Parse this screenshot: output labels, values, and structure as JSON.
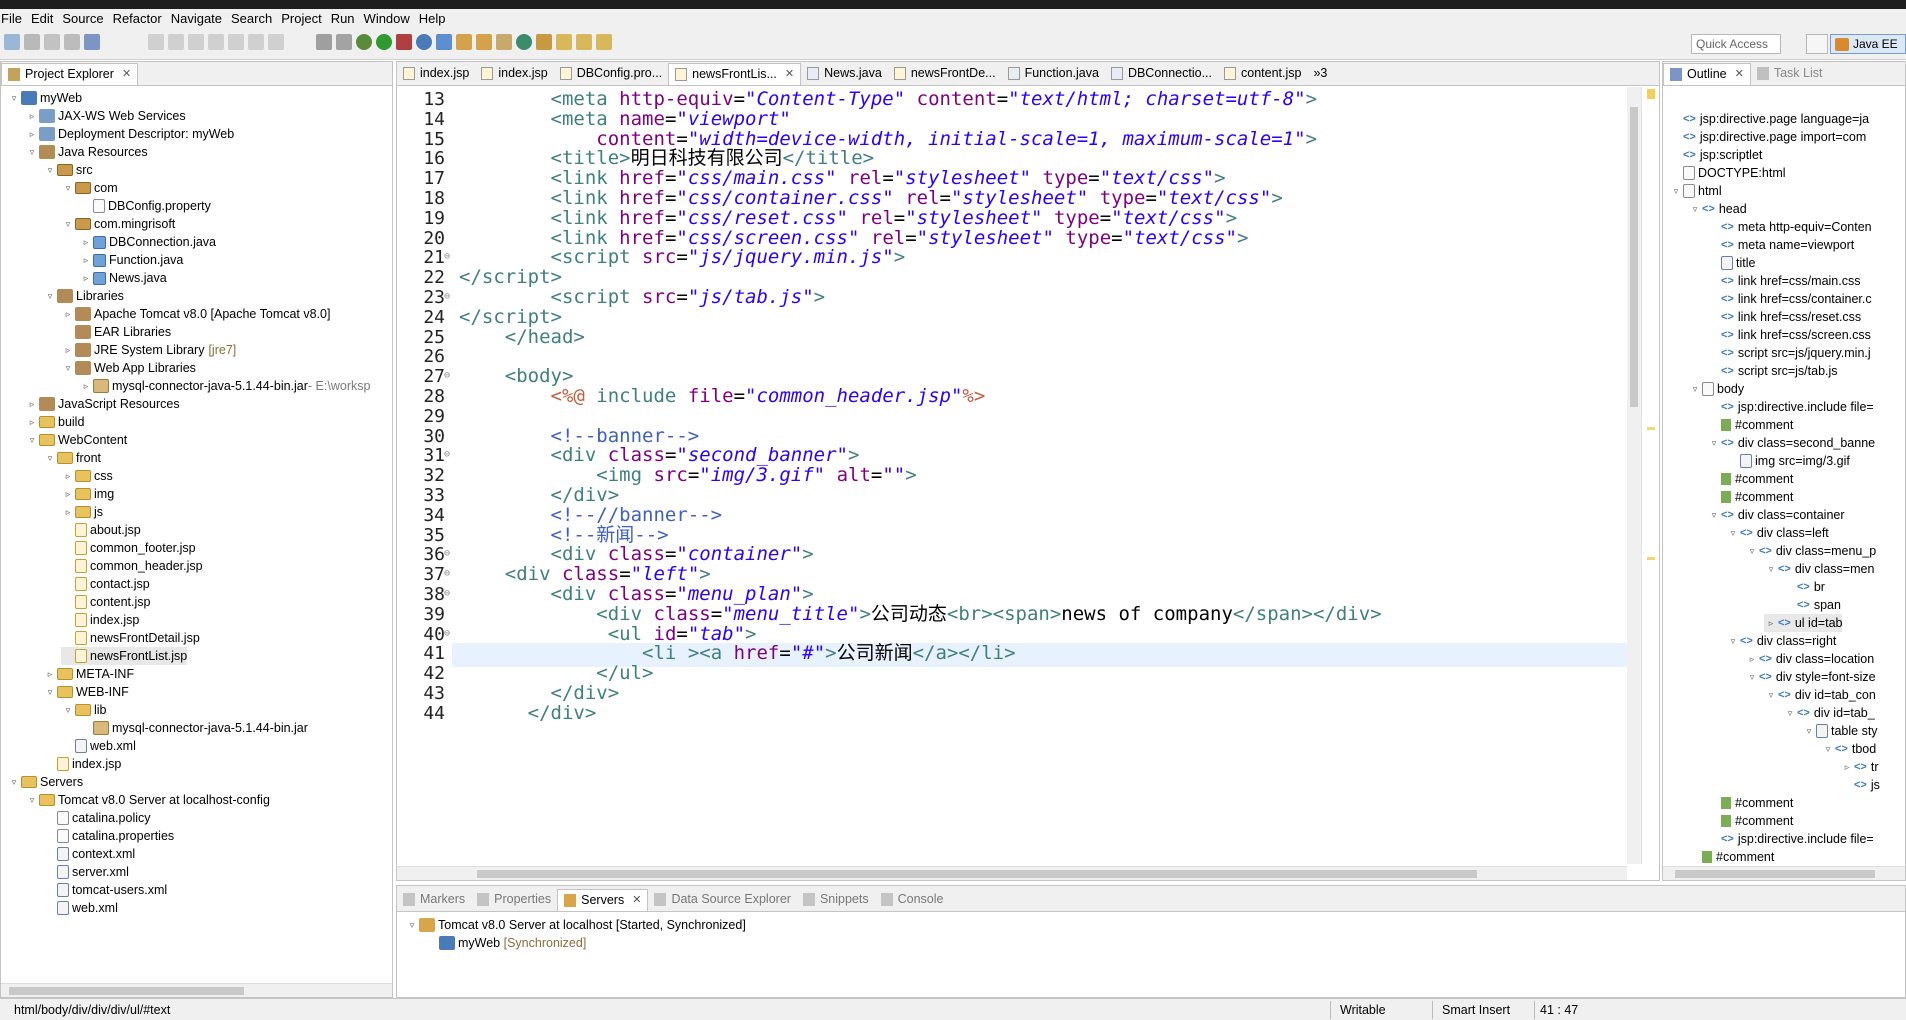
{
  "menu": [
    "File",
    "Edit",
    "Source",
    "Refactor",
    "Navigate",
    "Search",
    "Project",
    "Run",
    "Window",
    "Help"
  ],
  "quick_access": "Quick Access",
  "perspective": "Java EE",
  "project_explorer": {
    "title": "Project Explorer",
    "rows": [
      {
        "indent": 0,
        "tw": "▿",
        "icon": "proj",
        "label": "myWeb"
      },
      {
        "indent": 1,
        "tw": "▹",
        "icon": "ws",
        "label": "JAX-WS Web Services"
      },
      {
        "indent": 1,
        "tw": "▹",
        "icon": "ws",
        "label": "Deployment Descriptor: myWeb"
      },
      {
        "indent": 1,
        "tw": "▿",
        "icon": "lib",
        "label": "Java Resources"
      },
      {
        "indent": 2,
        "tw": "▿",
        "icon": "pkg",
        "label": "src"
      },
      {
        "indent": 3,
        "tw": "▿",
        "icon": "pkg",
        "label": "com"
      },
      {
        "indent": 4,
        "tw": "",
        "icon": "file",
        "label": "DBConfig.property"
      },
      {
        "indent": 3,
        "tw": "▿",
        "icon": "pkg",
        "label": "com.mingrisoft"
      },
      {
        "indent": 4,
        "tw": "▹",
        "icon": "java",
        "label": "DBConnection.java"
      },
      {
        "indent": 4,
        "tw": "▹",
        "icon": "java",
        "label": "Function.java"
      },
      {
        "indent": 4,
        "tw": "▹",
        "icon": "java",
        "label": "News.java"
      },
      {
        "indent": 2,
        "tw": "▿",
        "icon": "lib",
        "label": "Libraries"
      },
      {
        "indent": 3,
        "tw": "▹",
        "icon": "lib",
        "label": "Apache Tomcat v8.0 [Apache Tomcat v8.0]"
      },
      {
        "indent": 3,
        "tw": "",
        "icon": "lib",
        "label": "EAR Libraries"
      },
      {
        "indent": 3,
        "tw": "▹",
        "icon": "lib",
        "label": "JRE System Library",
        "dec": "[jre7]"
      },
      {
        "indent": 3,
        "tw": "▿",
        "icon": "lib",
        "label": "Web App Libraries"
      },
      {
        "indent": 4,
        "tw": "▹",
        "icon": "jar",
        "label": "mysql-connector-java-5.1.44-bin.jar",
        "dec2": " - E:\\worksp"
      },
      {
        "indent": 1,
        "tw": "▹",
        "icon": "lib",
        "label": "JavaScript Resources"
      },
      {
        "indent": 1,
        "tw": "▹",
        "icon": "folder",
        "label": "build"
      },
      {
        "indent": 1,
        "tw": "▿",
        "icon": "folder",
        "label": "WebContent"
      },
      {
        "indent": 2,
        "tw": "▿",
        "icon": "folder",
        "label": "front"
      },
      {
        "indent": 3,
        "tw": "▹",
        "icon": "folder",
        "label": "css"
      },
      {
        "indent": 3,
        "tw": "▹",
        "icon": "folder",
        "label": "img"
      },
      {
        "indent": 3,
        "tw": "▹",
        "icon": "folder",
        "label": "js"
      },
      {
        "indent": 3,
        "tw": "",
        "icon": "jsp",
        "label": "about.jsp"
      },
      {
        "indent": 3,
        "tw": "",
        "icon": "jsp",
        "label": "common_footer.jsp"
      },
      {
        "indent": 3,
        "tw": "",
        "icon": "jsp",
        "label": "common_header.jsp"
      },
      {
        "indent": 3,
        "tw": "",
        "icon": "jsp",
        "label": "contact.jsp"
      },
      {
        "indent": 3,
        "tw": "",
        "icon": "jsp",
        "label": "content.jsp"
      },
      {
        "indent": 3,
        "tw": "",
        "icon": "jsp",
        "label": "index.jsp"
      },
      {
        "indent": 3,
        "tw": "",
        "icon": "jsp",
        "label": "newsFrontDetail.jsp"
      },
      {
        "indent": 3,
        "tw": "",
        "icon": "jsp",
        "label": "newsFrontList.jsp",
        "selected": true
      },
      {
        "indent": 2,
        "tw": "▹",
        "icon": "folder",
        "label": "META-INF"
      },
      {
        "indent": 2,
        "tw": "▿",
        "icon": "folder",
        "label": "WEB-INF"
      },
      {
        "indent": 3,
        "tw": "▿",
        "icon": "folder",
        "label": "lib"
      },
      {
        "indent": 4,
        "tw": "",
        "icon": "jar",
        "label": "mysql-connector-java-5.1.44-bin.jar"
      },
      {
        "indent": 3,
        "tw": "",
        "icon": "xml",
        "label": "web.xml"
      },
      {
        "indent": 2,
        "tw": "",
        "icon": "jsp",
        "label": "index.jsp"
      },
      {
        "indent": 0,
        "tw": "▿",
        "icon": "folder",
        "label": "Servers"
      },
      {
        "indent": 1,
        "tw": "▿",
        "icon": "folder",
        "label": "Tomcat v8.0 Server at localhost-config"
      },
      {
        "indent": 2,
        "tw": "",
        "icon": "file",
        "label": "catalina.policy"
      },
      {
        "indent": 2,
        "tw": "",
        "icon": "file",
        "label": "catalina.properties"
      },
      {
        "indent": 2,
        "tw": "",
        "icon": "xml",
        "label": "context.xml"
      },
      {
        "indent": 2,
        "tw": "",
        "icon": "xml",
        "label": "server.xml"
      },
      {
        "indent": 2,
        "tw": "",
        "icon": "xml",
        "label": "tomcat-users.xml"
      },
      {
        "indent": 2,
        "tw": "",
        "icon": "xml",
        "label": "web.xml"
      }
    ]
  },
  "editor_tabs": [
    {
      "label": "index.jsp"
    },
    {
      "label": "index.jsp"
    },
    {
      "label": "DBConfig.pro..."
    },
    {
      "label": "newsFrontLis...",
      "active": true
    },
    {
      "label": "News.java"
    },
    {
      "label": "newsFrontDe..."
    },
    {
      "label": "Function.java"
    },
    {
      "label": "DBConnectio..."
    },
    {
      "label": "content.jsp"
    }
  ],
  "editor_overflow": "»3",
  "code_lines": [
    {
      "n": "13",
      "html": "        <span class='t'>&lt;meta</span> <span class='a'>http-equiv</span>=<span class='v'>\"Content-Type\"</span> <span class='a'>content</span>=<span class='v'>\"text/html; charset=utf-8\"</span><span class='t'>&gt;</span>"
    },
    {
      "n": "14",
      "html": "        <span class='t'>&lt;meta</span> <span class='a'>name</span>=<span class='v'>\"viewport\"</span>"
    },
    {
      "n": "15",
      "html": "            <span class='a'>content</span>=<span class='v'>\"width=device-width, initial-scale=1, maximum-scale=1\"</span><span class='t'>&gt;</span>"
    },
    {
      "n": "16",
      "html": "        <span class='t'>&lt;title&gt;</span>明日科技有限公司<span class='t'>&lt;/title&gt;</span>"
    },
    {
      "n": "17",
      "html": "        <span class='t'>&lt;link</span> <span class='a'>href</span>=<span class='v'>\"css/main.css\"</span> <span class='a'>rel</span>=<span class='v'>\"stylesheet\"</span> <span class='a'>type</span>=<span class='v'>\"text/css\"</span><span class='t'>&gt;</span>"
    },
    {
      "n": "18",
      "html": "        <span class='t'>&lt;link</span> <span class='a'>href</span>=<span class='v'>\"css/container.css\"</span> <span class='a'>rel</span>=<span class='v'>\"stylesheet\"</span> <span class='a'>type</span>=<span class='v'>\"text/css\"</span><span class='t'>&gt;</span>"
    },
    {
      "n": "19",
      "html": "        <span class='t'>&lt;link</span> <span class='a'>href</span>=<span class='v'>\"css/reset.css\"</span> <span class='a'>rel</span>=<span class='v'>\"stylesheet\"</span> <span class='a'>type</span>=<span class='v'>\"text/css\"</span><span class='t'>&gt;</span>"
    },
    {
      "n": "20",
      "html": "        <span class='t'>&lt;link</span> <span class='a'>href</span>=<span class='v'>\"css/screen.css\"</span> <span class='a'>rel</span>=<span class='v'>\"stylesheet\"</span> <span class='a'>type</span>=<span class='v'>\"text/css\"</span><span class='t'>&gt;</span>"
    },
    {
      "n": "21",
      "fold": true,
      "html": "        <span class='t'>&lt;script</span> <span class='a'>src</span>=<span class='v'>\"js/jquery.min.js\"</span><span class='t'>&gt;</span>"
    },
    {
      "n": "22",
      "html": "<span class='t'>&lt;/script&gt;</span>"
    },
    {
      "n": "23",
      "fold": true,
      "html": "        <span class='t'>&lt;script</span> <span class='a'>src</span>=<span class='v'>\"js/tab.js\"</span><span class='t'>&gt;</span>"
    },
    {
      "n": "24",
      "html": "<span class='t'>&lt;/script&gt;</span>"
    },
    {
      "n": "25",
      "html": "    <span class='t'>&lt;/head&gt;</span>"
    },
    {
      "n": "26",
      "html": ""
    },
    {
      "n": "27",
      "fold": true,
      "html": "    <span class='t'>&lt;body&gt;</span>"
    },
    {
      "n": "28",
      "html": "        <span class='d'>&lt;%@</span> <span class='t'>include</span> <span class='a'>file</span>=<span class='v'>\"common_header.jsp\"</span><span class='d'>%&gt;</span>"
    },
    {
      "n": "29",
      "html": ""
    },
    {
      "n": "30",
      "html": "        <span class='c'>&lt;!--banner--&gt;</span>"
    },
    {
      "n": "31",
      "fold": true,
      "html": "        <span class='t'>&lt;div</span> <span class='a'>class</span>=<span class='v'>\"second_banner\"</span><span class='t'>&gt;</span>"
    },
    {
      "n": "32",
      "html": "            <span class='t'>&lt;img</span> <span class='a'>src</span>=<span class='v'>\"img/3.gif\"</span> <span class='a'>alt</span>=<span class='v'>\"\"</span><span class='t'>&gt;</span>"
    },
    {
      "n": "33",
      "html": "        <span class='t'>&lt;/div&gt;</span>"
    },
    {
      "n": "34",
      "html": "        <span class='c'>&lt;!--//banner--&gt;</span>"
    },
    {
      "n": "35",
      "html": "        <span class='c'>&lt;!--新闻--&gt;</span>"
    },
    {
      "n": "36",
      "fold": true,
      "html": "        <span class='t'>&lt;div</span> <span class='a'>class</span>=<span class='v'>\"container\"</span><span class='t'>&gt;</span>"
    },
    {
      "n": "37",
      "fold": true,
      "html": "    <span class='t'>&lt;div</span> <span class='a'>class</span>=<span class='v'>\"left\"</span><span class='t'>&gt;</span>"
    },
    {
      "n": "38",
      "fold": true,
      "html": "        <span class='t'>&lt;div</span> <span class='a'>class</span>=<span class='v'>\"menu_plan\"</span><span class='t'>&gt;</span>"
    },
    {
      "n": "39",
      "html": "            <span class='t'>&lt;div</span> <span class='a'>class</span>=<span class='v'>\"menu_title\"</span><span class='t'>&gt;</span>公司动态<span class='t'>&lt;br&gt;&lt;span&gt;</span>news of company<span class='t'>&lt;/span&gt;&lt;/div&gt;</span>"
    },
    {
      "n": "40",
      "fold": true,
      "html": "             <span class='t'>&lt;ul</span> <span class='a'>id</span>=<span class='v'>\"tab\"</span><span class='t'>&gt;</span>"
    },
    {
      "n": "41",
      "current": true,
      "html": "                <span class='t'>&lt;li</span> <span class='t'>&gt;&lt;a</span> <span class='a'>href</span>=<span class='v'>\"#\"</span><span class='t'>&gt;</span>公司新闻<span class='t'>&lt;/a&gt;&lt;/li&gt;</span>"
    },
    {
      "n": "42",
      "html": "            <span class='t'>&lt;/ul&gt;</span>"
    },
    {
      "n": "43",
      "html": "        <span class='t'>&lt;/div&gt;</span>"
    },
    {
      "n": "44",
      "html": "      <span class='t'>&lt;/div&gt;</span>"
    }
  ],
  "outline": {
    "tabs": [
      {
        "label": "Outline",
        "active": true
      },
      {
        "label": "Task List"
      }
    ],
    "rows": [
      {
        "indent": 0,
        "tw": "",
        "kind": "tag",
        "label": "jsp:directive.page language=ja"
      },
      {
        "indent": 0,
        "tw": "",
        "kind": "tag",
        "label": "jsp:directive.page import=com"
      },
      {
        "indent": 0,
        "tw": "",
        "kind": "tag",
        "label": "jsp:scriptlet"
      },
      {
        "indent": 0,
        "tw": "",
        "kind": "doc",
        "label": "DOCTYPE:html"
      },
      {
        "indent": 0,
        "tw": "▿",
        "kind": "doc",
        "label": "html"
      },
      {
        "indent": 1,
        "tw": "▿",
        "kind": "tag",
        "label": "head"
      },
      {
        "indent": 2,
        "tw": "",
        "kind": "tag",
        "label": "meta http-equiv=Conten"
      },
      {
        "indent": 2,
        "tw": "",
        "kind": "tag",
        "label": "meta name=viewport"
      },
      {
        "indent": 2,
        "tw": "",
        "kind": "tbl",
        "label": "title"
      },
      {
        "indent": 2,
        "tw": "",
        "kind": "tag",
        "label": "link href=css/main.css"
      },
      {
        "indent": 2,
        "tw": "",
        "kind": "tag",
        "label": "link href=css/container.c"
      },
      {
        "indent": 2,
        "tw": "",
        "kind": "tag",
        "label": "link href=css/reset.css"
      },
      {
        "indent": 2,
        "tw": "",
        "kind": "tag",
        "label": "link href=css/screen.css"
      },
      {
        "indent": 2,
        "tw": "",
        "kind": "tag",
        "label": "script src=js/jquery.min.j"
      },
      {
        "indent": 2,
        "tw": "",
        "kind": "tag",
        "label": "script src=js/tab.js"
      },
      {
        "indent": 1,
        "tw": "▿",
        "kind": "doc",
        "label": "body"
      },
      {
        "indent": 2,
        "tw": "",
        "kind": "tag",
        "label": "jsp:directive.include file="
      },
      {
        "indent": 2,
        "tw": "",
        "kind": "cmt",
        "label": "#comment"
      },
      {
        "indent": 2,
        "tw": "▿",
        "kind": "tag",
        "label": "div class=second_banne"
      },
      {
        "indent": 3,
        "tw": "",
        "kind": "tbl",
        "label": "img src=img/3.gif"
      },
      {
        "indent": 2,
        "tw": "",
        "kind": "cmt",
        "label": "#comment"
      },
      {
        "indent": 2,
        "tw": "",
        "kind": "cmt",
        "label": "#comment"
      },
      {
        "indent": 2,
        "tw": "▿",
        "kind": "tag",
        "label": "div class=container"
      },
      {
        "indent": 3,
        "tw": "▿",
        "kind": "tag",
        "label": "div class=left"
      },
      {
        "indent": 4,
        "tw": "▿",
        "kind": "tag",
        "label": "div class=menu_p"
      },
      {
        "indent": 5,
        "tw": "▿",
        "kind": "tag",
        "label": "div class=men"
      },
      {
        "indent": 6,
        "tw": "",
        "kind": "tag",
        "label": "br"
      },
      {
        "indent": 6,
        "tw": "",
        "kind": "tag",
        "label": "span"
      },
      {
        "indent": 5,
        "tw": "▹",
        "kind": "tag",
        "label": "ul id=tab",
        "selected": true
      },
      {
        "indent": 3,
        "tw": "▿",
        "kind": "tag",
        "label": "div class=right"
      },
      {
        "indent": 4,
        "tw": "▹",
        "kind": "tag",
        "label": "div class=location"
      },
      {
        "indent": 4,
        "tw": "▿",
        "kind": "tag",
        "label": "div style=font-size"
      },
      {
        "indent": 5,
        "tw": "▿",
        "kind": "tag",
        "label": "div id=tab_con"
      },
      {
        "indent": 6,
        "tw": "▿",
        "kind": "tag",
        "label": "div id=tab_"
      },
      {
        "indent": 7,
        "tw": "▿",
        "kind": "tbl",
        "label": "table sty"
      },
      {
        "indent": 8,
        "tw": "▿",
        "kind": "tag",
        "label": "tbod"
      },
      {
        "indent": 9,
        "tw": "▹",
        "kind": "tag",
        "label": "tr"
      },
      {
        "indent": 9,
        "tw": "",
        "kind": "tag",
        "label": "js"
      },
      {
        "indent": 2,
        "tw": "",
        "kind": "cmt",
        "label": "#comment"
      },
      {
        "indent": 2,
        "tw": "",
        "kind": "cmt",
        "label": "#comment"
      },
      {
        "indent": 2,
        "tw": "",
        "kind": "tag",
        "label": "jsp:directive.include file="
      },
      {
        "indent": 1,
        "tw": "",
        "kind": "cmt",
        "label": "#comment"
      }
    ]
  },
  "bottom_tabs": [
    {
      "label": "Markers"
    },
    {
      "label": "Properties"
    },
    {
      "label": "Servers",
      "active": true
    },
    {
      "label": "Data Source Explorer"
    },
    {
      "label": "Snippets"
    },
    {
      "label": "Console"
    }
  ],
  "servers": {
    "server_label": "Tomcat v8.0 Server at localhost",
    "server_state": "[Started, Synchronized]",
    "module_label": "myWeb",
    "module_state": "[Synchronized]"
  },
  "status": {
    "path": "html/body/div/div/div/ul/#text",
    "writable": "Writable",
    "insert_mode": "Smart Insert",
    "position": "41 : 47"
  }
}
